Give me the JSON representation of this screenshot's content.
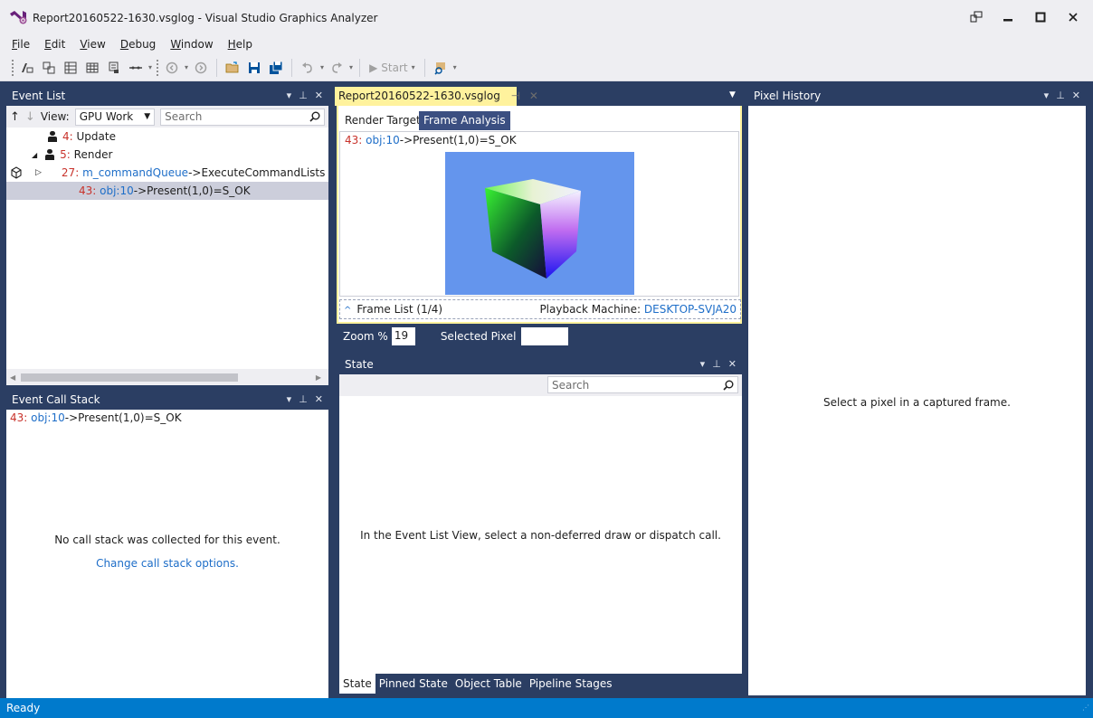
{
  "window": {
    "title": "Report20160522-1630.vsglog - Visual Studio Graphics Analyzer",
    "controls": {
      "restore": "⧉",
      "minimize": "—",
      "maximize": "☐",
      "close": "✕"
    }
  },
  "menu": {
    "file": {
      "u": "F",
      "rest": "ile"
    },
    "edit": {
      "u": "E",
      "rest": "dit"
    },
    "view": {
      "u": "V",
      "rest": "iew"
    },
    "debug": {
      "u": "D",
      "rest": "ebug"
    },
    "window": {
      "u": "W",
      "rest": "indow"
    },
    "help": {
      "u": "H",
      "rest": "elp"
    }
  },
  "toolbar": {
    "start_label": "Start"
  },
  "event_list": {
    "title": "Event List",
    "view_label": "View:",
    "view_value": "GPU Work",
    "search_placeholder": "Search",
    "rows": [
      {
        "num": "4:",
        "text": "Update"
      },
      {
        "num": "5:",
        "text": "Render"
      },
      {
        "num": "27:",
        "obj": "m_commandQueue",
        "text": "->ExecuteCommandLists"
      },
      {
        "num": "43:",
        "obj": "obj:10",
        "text": "->Present(1,0)=S_OK"
      }
    ]
  },
  "call_stack": {
    "title": "Event Call Stack",
    "entry_num": "43:",
    "entry_obj": "obj:10",
    "entry_text": "->Present(1,0)=S_OK",
    "message": "No call stack was collected for this event.",
    "link": "Change call stack options."
  },
  "document": {
    "tab_label": "Report20160522-1630.vsglog",
    "inner_tabs": [
      "Render Target",
      "Frame Analysis"
    ],
    "event_num": "43:",
    "event_obj": "obj:10",
    "event_text": "->Present(1,0)=S_OK",
    "frame_list": "Frame List (1/4)",
    "playback_label": "Playback Machine:",
    "playback_machine": "DESKTOP-SVJA20",
    "zoom_label": "Zoom %",
    "zoom_value": "19",
    "selected_pixel_label": "Selected Pixel",
    "render_background": "#6495ed"
  },
  "state": {
    "title": "State",
    "search_placeholder": "Search",
    "message": "In the Event List View, select a non-deferred draw or dispatch call.",
    "bottom_tabs": [
      "State",
      "Pinned State",
      "Object Table",
      "Pipeline Stages"
    ]
  },
  "pixel_history": {
    "title": "Pixel History",
    "message": "Select a pixel in a captured frame."
  },
  "status": {
    "text": "Ready"
  },
  "colors": {
    "accent": "#007acc",
    "panel_header": "#2b3e63",
    "doc_tab": "#fff29d"
  }
}
